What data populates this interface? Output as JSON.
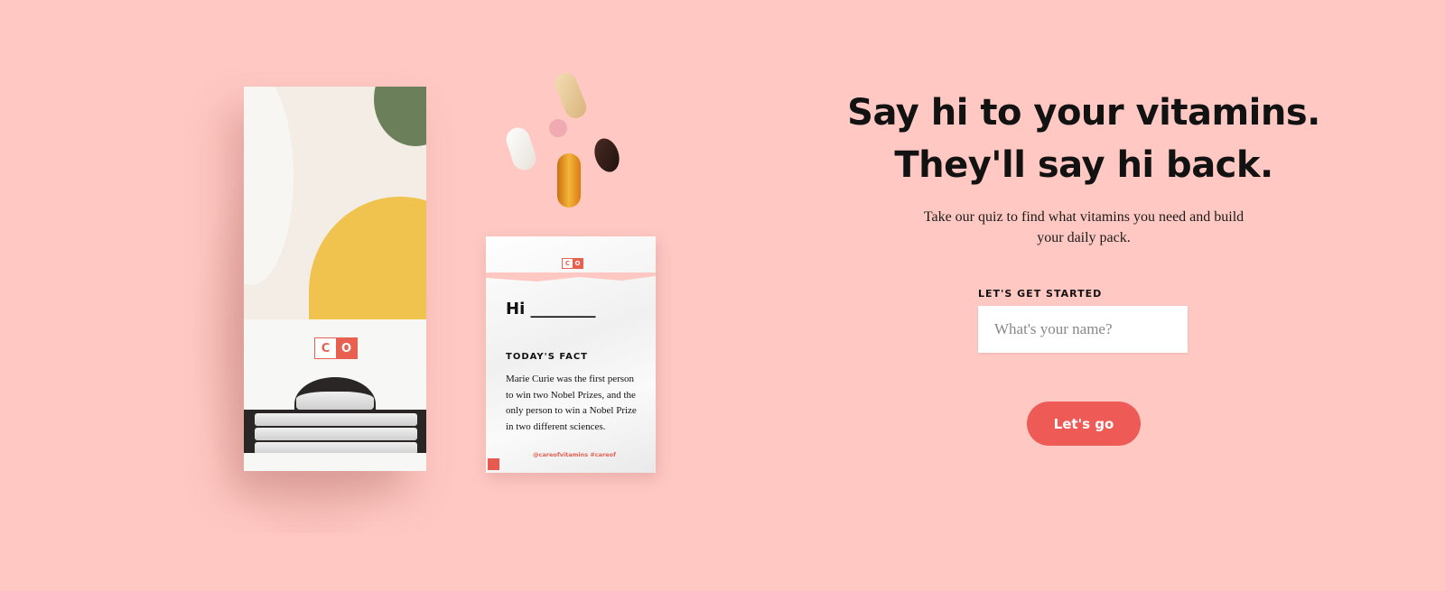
{
  "hero": {
    "headline_line1": "Say hi to your vitamins.",
    "headline_line2": "They'll say hi back.",
    "subtext": "Take our quiz to find what vitamins you need and build your daily pack."
  },
  "form": {
    "label": "LET'S GET STARTED",
    "name_placeholder": "What's your name?",
    "name_value": "",
    "submit_label": "Let's go"
  },
  "product": {
    "box_logo": [
      "C",
      "O"
    ],
    "sachet": {
      "greeting": "Hi ________",
      "fact_title": "TODAY'S FACT",
      "fact_body": "Marie Curie was the first person to win two Nobel Prizes, and the only person to win a Nobel Prize in two different sciences.",
      "hashtags": "@careofvitamins  #careof"
    }
  },
  "colors": {
    "background": "#ffc8c2",
    "accent": "#ee5a55",
    "brand_logo": "#e8604f",
    "text": "#121212"
  }
}
